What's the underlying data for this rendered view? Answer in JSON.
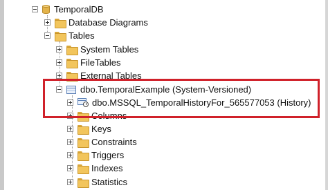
{
  "tree": {
    "database": "TemporalDB",
    "database_diagrams": "Database Diagrams",
    "tables": "Tables",
    "system_tables": "System Tables",
    "file_tables": "FileTables",
    "external_tables": "External Tables",
    "temporal_table": "dbo.TemporalExample (System-Versioned)",
    "history_table": "dbo.MSSQL_TemporalHistoryFor_565577053 (History)",
    "columns": "Columns",
    "keys": "Keys",
    "constraints": "Constraints",
    "triggers": "Triggers",
    "indexes": "Indexes",
    "statistics": "Statistics"
  },
  "colors": {
    "highlight_border": "#d0212a",
    "folder": "#f2c55c"
  }
}
